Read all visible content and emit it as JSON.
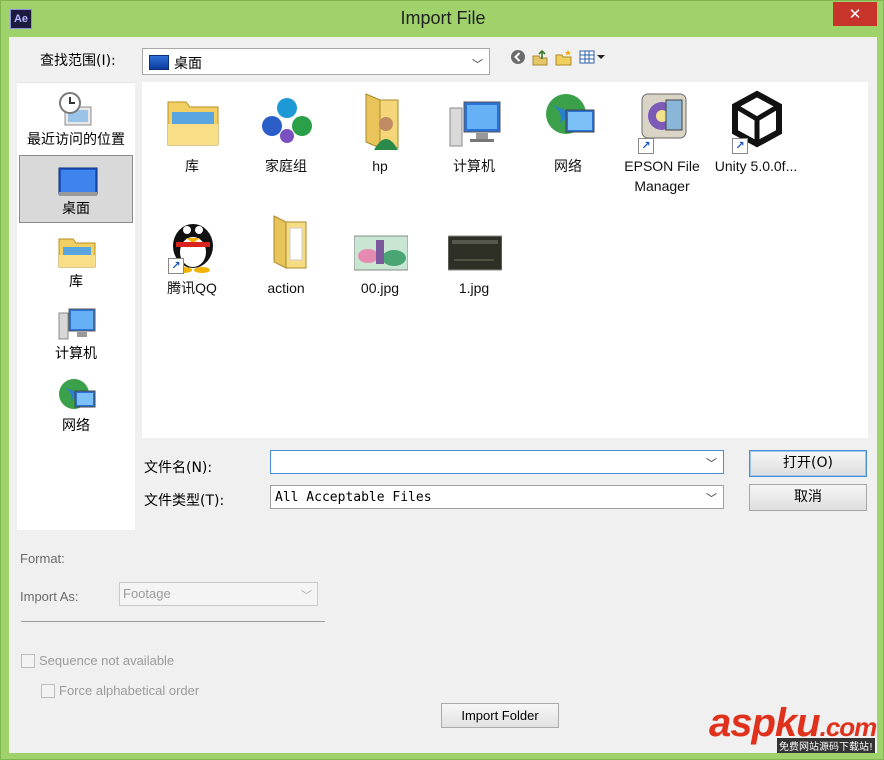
{
  "window": {
    "title": "Import File",
    "app_icon_text": "Ae",
    "close_glyph": "✕"
  },
  "lookin": {
    "label": "查找范围(I):",
    "value": "桌面"
  },
  "toolbar": {
    "icons": [
      "back-icon",
      "up-folder-icon",
      "new-folder-icon",
      "view-menu-icon"
    ]
  },
  "places": [
    {
      "label": "最近访问的位置",
      "icon": "recent-places-icon",
      "selected": false
    },
    {
      "label": "桌面",
      "icon": "desktop-icon",
      "selected": true
    },
    {
      "label": "库",
      "icon": "library-icon",
      "selected": false
    },
    {
      "label": "计算机",
      "icon": "computer-icon",
      "selected": false
    },
    {
      "label": "网络",
      "icon": "network-icon",
      "selected": false
    }
  ],
  "files": [
    {
      "name": "库",
      "icon": "library-icon"
    },
    {
      "name": "家庭组",
      "icon": "homegroup-icon"
    },
    {
      "name": "hp",
      "icon": "user-folder-icon"
    },
    {
      "name": "计算机",
      "icon": "computer-icon"
    },
    {
      "name": "网络",
      "icon": "network-icon"
    },
    {
      "name": "EPSON File Manager",
      "icon": "epson-shortcut-icon"
    },
    {
      "name": "Unity 5.0.0f...",
      "icon": "unity-shortcut-icon"
    },
    {
      "name": "腾讯QQ",
      "icon": "qq-shortcut-icon"
    },
    {
      "name": "action",
      "icon": "folder-icon"
    },
    {
      "name": "00.jpg",
      "icon": "image-thumbnail-icon"
    },
    {
      "name": "1.jpg",
      "icon": "image-thumbnail-icon"
    }
  ],
  "filename": {
    "label": "文件名(N):",
    "value": ""
  },
  "filetype": {
    "label": "文件类型(T):",
    "value": "All Acceptable Files"
  },
  "buttons": {
    "open": "打开(O)",
    "cancel": "取消",
    "import_folder": "Import Folder"
  },
  "options": {
    "format_label": "Format:",
    "import_as_label": "Import As:",
    "import_as_value": "Footage",
    "sequence_label": "Sequence not available",
    "force_alpha_label": "Force alphabetical order"
  },
  "watermark": {
    "main": "aspku",
    "dot": ".com",
    "sub": "免费网站源码下载站!"
  },
  "colors": {
    "frame": "#9fd26a",
    "close": "#c7342a",
    "watermark": "#e0311c"
  }
}
